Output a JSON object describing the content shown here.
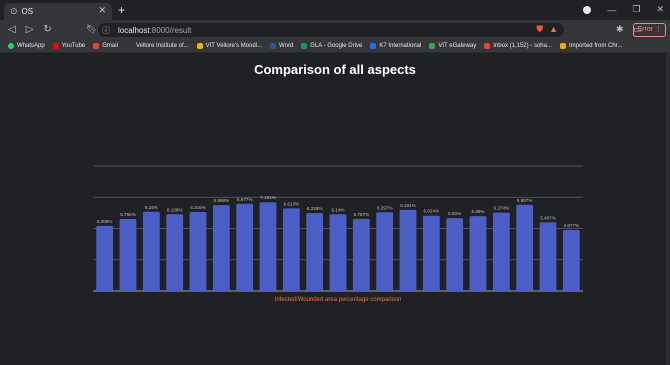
{
  "browser": {
    "tab_title": "OS",
    "address_host": "localhost",
    "address_path": ":8000/result",
    "error_label": "Error",
    "bookmarks": [
      "WhatsApp",
      "YouTube",
      "Gmail",
      "Vellore Institute of...",
      "VIT Vellore's Moodl...",
      "Word",
      "GLA - Google Drive",
      "K7 International",
      "VIT eGateway",
      "Inbox (1,152) - soha...",
      "Imported from Chr..."
    ],
    "bookmark_colors": [
      "#25d366",
      "#ff0000",
      "#ea4335",
      "#3b5998",
      "#f4b400",
      "#2b579a",
      "#0f9d58",
      "#1a73e8",
      "#34a853",
      "#ea4335",
      "#f9ab00"
    ]
  },
  "chart_data": {
    "type": "bar",
    "title": "Comparison of all aspects",
    "xlabel": "Infected/Wounded area percentage comparison",
    "ylim": [
      0,
      10
    ],
    "bar_color": "#4c5fc7",
    "xlabel_color": "#e8743b",
    "values": [
      5.208,
      5.765,
      6.34,
      6.138,
      6.316,
      6.868,
      6.977,
      7.101,
      6.613,
      6.228,
      6.14,
      5.767,
      6.297,
      6.491,
      6.024,
      5.83,
      5.99,
      6.274,
      6.897,
      5.487,
      4.877
    ],
    "data_labels": [
      "5.208%",
      "5.765%",
      "6.34%",
      "6.138%",
      "6.316%",
      "6.868%",
      "6.977%",
      "7.101%",
      "6.613%",
      "6.228%",
      "6.14%",
      "5.767%",
      "6.297%",
      "6.491%",
      "6.024%",
      "5.83%",
      "5.99%",
      "6.274%",
      "6.897%",
      "5.487%",
      "4.877%"
    ]
  }
}
